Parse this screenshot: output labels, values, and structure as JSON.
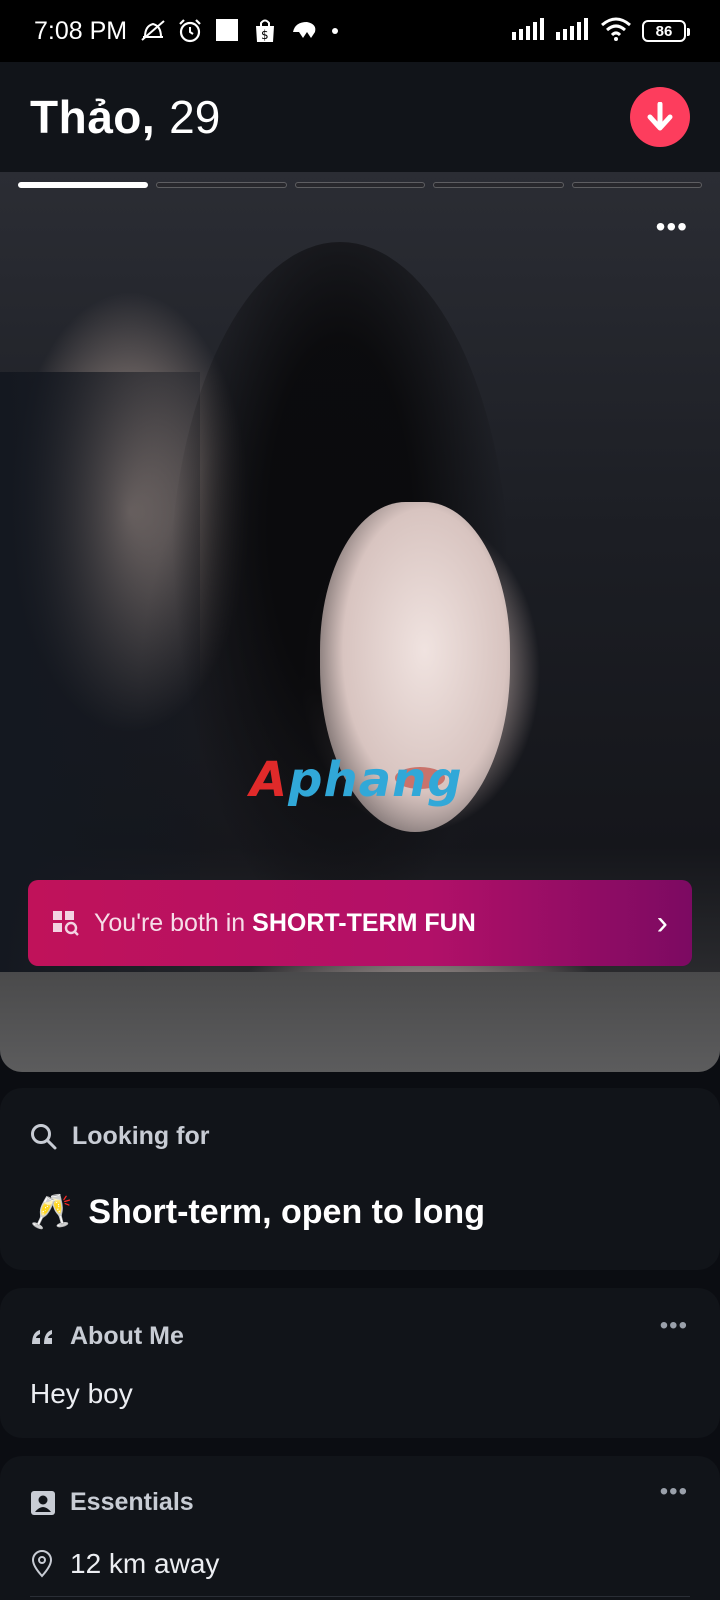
{
  "status_bar": {
    "time": "7:08 PM",
    "battery": "86"
  },
  "header": {
    "name": "Thảo,",
    "age": "29"
  },
  "photo": {
    "progress_total": 5,
    "progress_active": 1,
    "more_label": "•••",
    "watermark": "Aphang",
    "match_banner": {
      "prefix": "You're both in ",
      "highlight": "SHORT-TERM FUN",
      "arrow": "›"
    }
  },
  "looking_for": {
    "title": "Looking for",
    "emoji": "🥂",
    "value": "Short-term, open to long"
  },
  "about": {
    "title": "About Me",
    "more_label": "•••",
    "text": "Hey boy"
  },
  "essentials": {
    "title": "Essentials",
    "more_label": "•••",
    "distance": "12 km away"
  },
  "colors": {
    "accent": "#fd3d5d",
    "banner_start": "#c0125a",
    "banner_end": "#7c0a62",
    "card_bg": "#111419",
    "page_bg": "#0b0d12"
  }
}
